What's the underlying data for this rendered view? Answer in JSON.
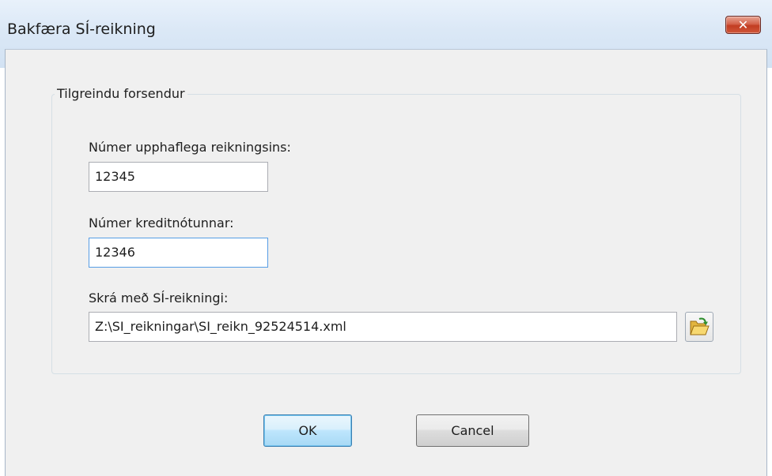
{
  "window": {
    "title": "Bakfæra SÍ-reikning",
    "close_glyph": "✕"
  },
  "group": {
    "legend": "Tilgreindu forsendur"
  },
  "fields": {
    "original_invoice_label": "Númer upphaflega reikningsins:",
    "original_invoice_value": "12345",
    "credit_note_label": "Númer kreditnótunnar:",
    "credit_note_value": "12346",
    "file_label": "Skrá með SÍ-reikningi:",
    "file_value": "Z:\\SI_reikningar\\SI_reikn_92524514.xml"
  },
  "buttons": {
    "ok": "OK",
    "cancel": "Cancel"
  },
  "icons": {
    "browse": "open-folder-icon",
    "close": "close-icon"
  },
  "colors": {
    "titlebar": "#dbe8f6",
    "close_button": "#c7432a",
    "focus_border": "#569de5",
    "default_button": "#bee6fd"
  }
}
